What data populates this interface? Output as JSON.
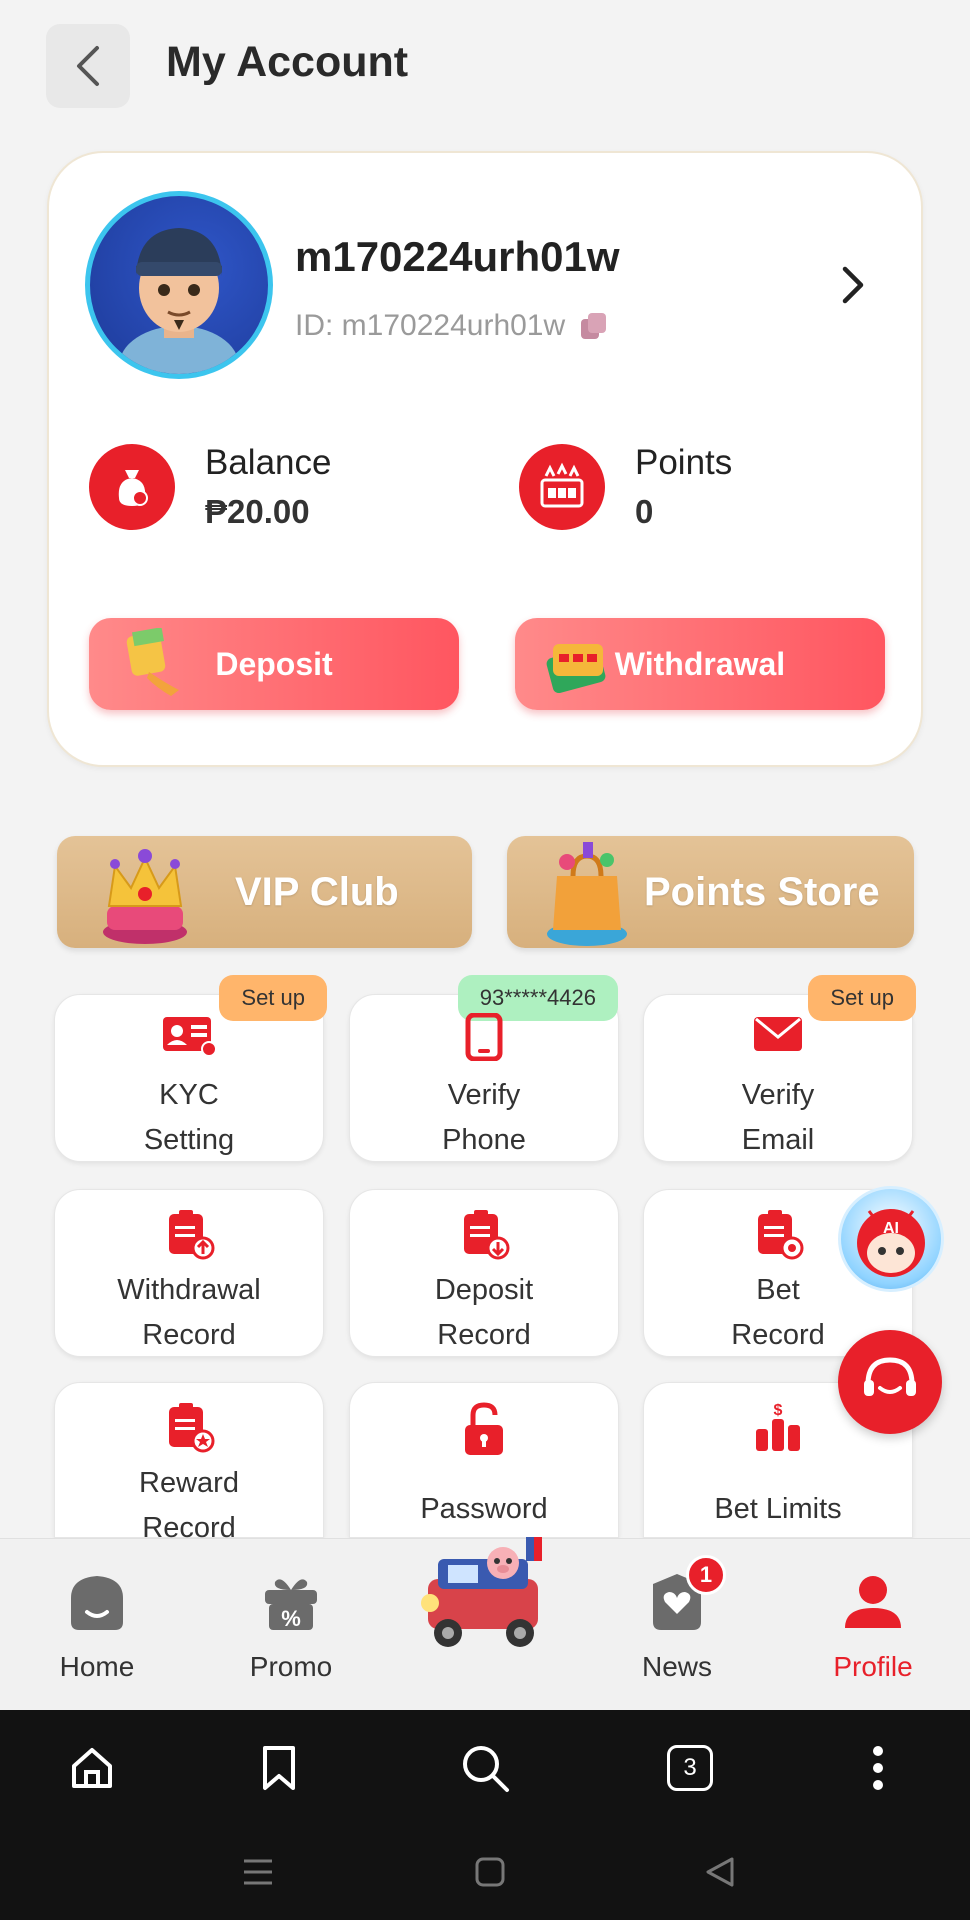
{
  "header": {
    "title": "My Account"
  },
  "profile": {
    "username": "m170224urh01w",
    "id_text": "ID: m170224urh01w",
    "balance_label": "Balance",
    "balance_value": "₱20.00",
    "points_label": "Points",
    "points_value": "0",
    "deposit_label": "Deposit",
    "withdrawal_label": "Withdrawal"
  },
  "banners": {
    "vip": "VIP Club",
    "store": "Points Store"
  },
  "tiles": [
    {
      "line1": "KYC",
      "line2": "Setting",
      "badge": "Set up"
    },
    {
      "line1": "Verify",
      "line2": "Phone",
      "badge": "93*****4426"
    },
    {
      "line1": "Verify",
      "line2": "Email",
      "badge": "Set up"
    },
    {
      "line1": "Withdrawal",
      "line2": "Record"
    },
    {
      "line1": "Deposit",
      "line2": "Record"
    },
    {
      "line1": "Bet",
      "line2": "Record"
    },
    {
      "line1": "Reward",
      "line2": "Record"
    },
    {
      "line1": "Password"
    },
    {
      "line1": "Bet Limits"
    }
  ],
  "nav": {
    "home": "Home",
    "promo": "Promo",
    "news": "News",
    "news_badge": "1",
    "profile": "Profile"
  },
  "browser": {
    "tab_count": "3"
  },
  "colors": {
    "accent": "#e8202a",
    "gold": "#d7b07d",
    "badge_orange": "#ffb56b",
    "badge_green": "#aef0c0"
  }
}
